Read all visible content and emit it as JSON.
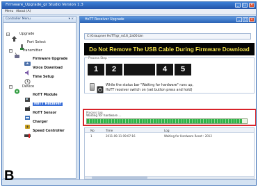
{
  "window": {
    "title": "Firmware_Upgrade_gr Studio  Version 1.3",
    "buttons": {
      "minimize": "_",
      "maximize": "□",
      "close": "×"
    }
  },
  "menu": {
    "items": [
      "Menu",
      "About (A)"
    ]
  },
  "sidebar": {
    "header": "Controller Menu",
    "pin": "▾ ×",
    "tree": {
      "upgrade": "Upgrade",
      "port_select": "Port Select",
      "transmitter": "Transmitter",
      "firmware_upgrade": "Firmware Upgrade",
      "voice_download": "Voice Download",
      "time_setup": "Time Setup",
      "device": "Device",
      "hott_module": "HoTT Module",
      "hott_receiver": "HoTT Receiver",
      "hott_sensor": "HoTT Sensor",
      "charger": "Charger",
      "speed_controller": "Speed Controller"
    },
    "expand_symbol": "−"
  },
  "main": {
    "header": "HoTT Receiver Upgrade",
    "file_path": "C:\\Graupner HoTT\\gr_rx16_2a00.bin",
    "warning": "Do Not Remove The USB Cable During Firmware Download",
    "process_group_label": "Process Step",
    "steps": [
      "1",
      "2",
      "",
      "4",
      "5"
    ],
    "instruction_1": "While the status bar \"Waiting for hardware\" runs up,",
    "instruction_2": "HoTT receiver switch on (set button press and hold)",
    "log_group_label": "Process Log",
    "log_message": "Waiting for hardware ...",
    "progress": 0.97,
    "table": {
      "columns": [
        "No",
        "Time",
        "Log"
      ],
      "rows": [
        [
          "1",
          "2011-09-11 09:07:16",
          "Waiting for Hardware Reset : 2012"
        ]
      ]
    }
  },
  "figure_label": "B"
}
